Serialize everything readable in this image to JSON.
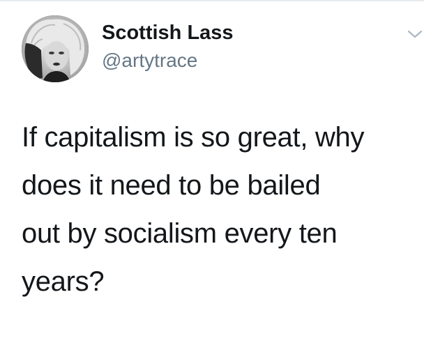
{
  "tweet": {
    "display_name": "Scottish Lass",
    "handle": "@artytrace",
    "text": "If capitalism is so great, why\ndoes it need to be bailed\nout by socialism every ten\nyears?",
    "avatar_icon": "profile-photo",
    "menu_icon": "chevron-down-icon"
  },
  "colors": {
    "name": "#14171a",
    "handle": "#657786",
    "caret": "#aab8c2",
    "background": "#ffffff"
  }
}
